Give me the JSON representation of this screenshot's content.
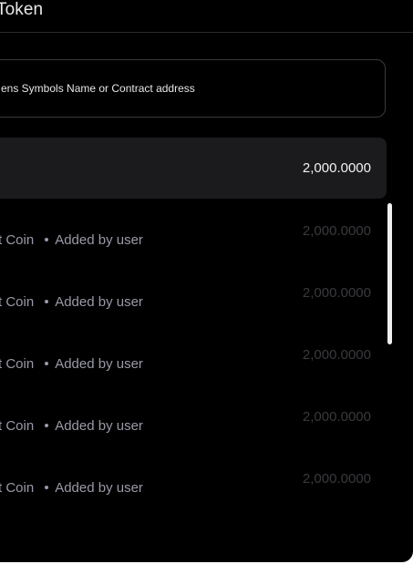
{
  "header": {
    "title": "Token"
  },
  "search": {
    "placeholder": "ens Symbols Name or Contract address"
  },
  "selected": {
    "balance": "2,000.0000"
  },
  "tokens": [
    {
      "name": "t Coin",
      "tag": "Added by user",
      "balance": "2,000.0000"
    },
    {
      "name": "t Coin",
      "tag": "Added by user",
      "balance": "2,000.0000"
    },
    {
      "name": "t Coin",
      "tag": "Added by user",
      "balance": "2,000.0000"
    },
    {
      "name": "t Coin",
      "tag": "Added by user",
      "balance": "2,000.0000"
    },
    {
      "name": "t Coin",
      "tag": "Added by user",
      "balance": "2,000.0000"
    }
  ],
  "colors": {
    "background": "#000000",
    "selected_row": "#1b1b1e",
    "muted_text": "#9a9aa8",
    "dim_balance": "#3a3a3e"
  }
}
